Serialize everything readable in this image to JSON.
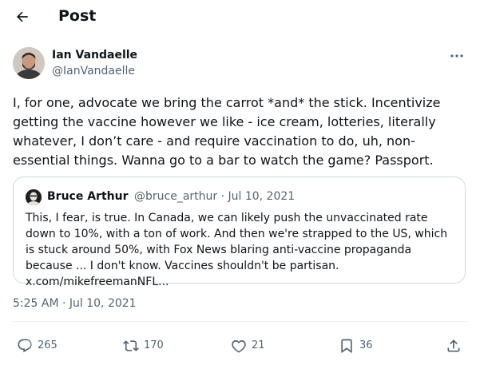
{
  "header": {
    "title": "Post",
    "back_icon": "arrow-left-icon"
  },
  "author": {
    "name": "Ian Vandaelle",
    "handle": "@IanVandaelle"
  },
  "tweet": {
    "text": "I, for one, advocate we bring the carrot *and* the stick. Incentivize getting the vaccine however we like - ice cream, lotteries, literally whatever, I don’t care - and require vaccination to do, uh, non-essential things. Wanna go to a bar to watch the game? Passport.",
    "timestamp": "5:25 AM · Jul 10, 2021"
  },
  "quote": {
    "name": "Bruce Arthur",
    "meta": "@bruce_arthur · Jul 10, 2021",
    "text": "This, I fear, is true. In Canada, we can likely push the unvaccinated rate down to 10%, with a ton of work. And then we're strapped to the US, which is stuck around 50%, with Fox News blaring anti-vaccine propaganda because ... I don't know. Vaccines shouldn't be partisan. x.com/mikefreemanNFL..."
  },
  "actions": {
    "replies": "265",
    "reposts": "170",
    "likes": "21",
    "bookmarks": "36"
  },
  "colors": {
    "text": "#0f1419",
    "secondary": "#536471",
    "border": "#cfd9de"
  }
}
